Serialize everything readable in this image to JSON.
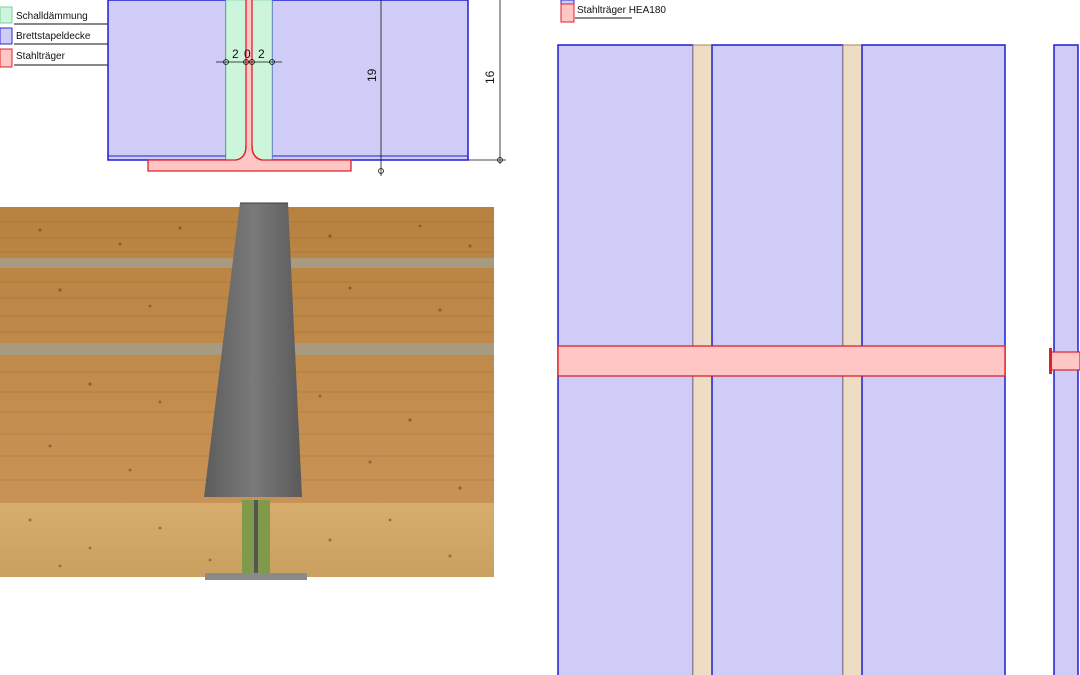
{
  "legend_left": {
    "items": [
      {
        "label": "Schalldämmung",
        "color": "#ccf5dc",
        "border": "#7fcf9f"
      },
      {
        "label": "Brettstapeldecke",
        "color": "#cfcdf7",
        "border": "#2a2ad0"
      },
      {
        "label": "Stahlträger",
        "color": "#ffc6c6",
        "border": "#e0202a"
      }
    ]
  },
  "section": {
    "dim_flange_gap": [
      "2",
      "0",
      "2"
    ],
    "dim_height_inner": "19",
    "dim_height_outer": "16"
  },
  "legend_right": {
    "items": [
      {
        "label": "Stahlträger HEA180",
        "color": "#ffc6c6",
        "border": "#e0202a"
      }
    ]
  },
  "colors": {
    "slab_fill": "#cfcdf7",
    "slab_stroke": "#1f1fd0",
    "joint_fill": "#efdcc4",
    "joint_stroke": "#a88a5a",
    "beam_fill": "#ffc6c6",
    "beam_stroke": "#e0202a",
    "insulation_fill": "#ccf5dc",
    "wood": "#c48a4a",
    "wood_dark": "#9a6a34",
    "steel_dark": "#666666"
  },
  "icons": {
    "render_view": "timber-floor-3d-render"
  }
}
